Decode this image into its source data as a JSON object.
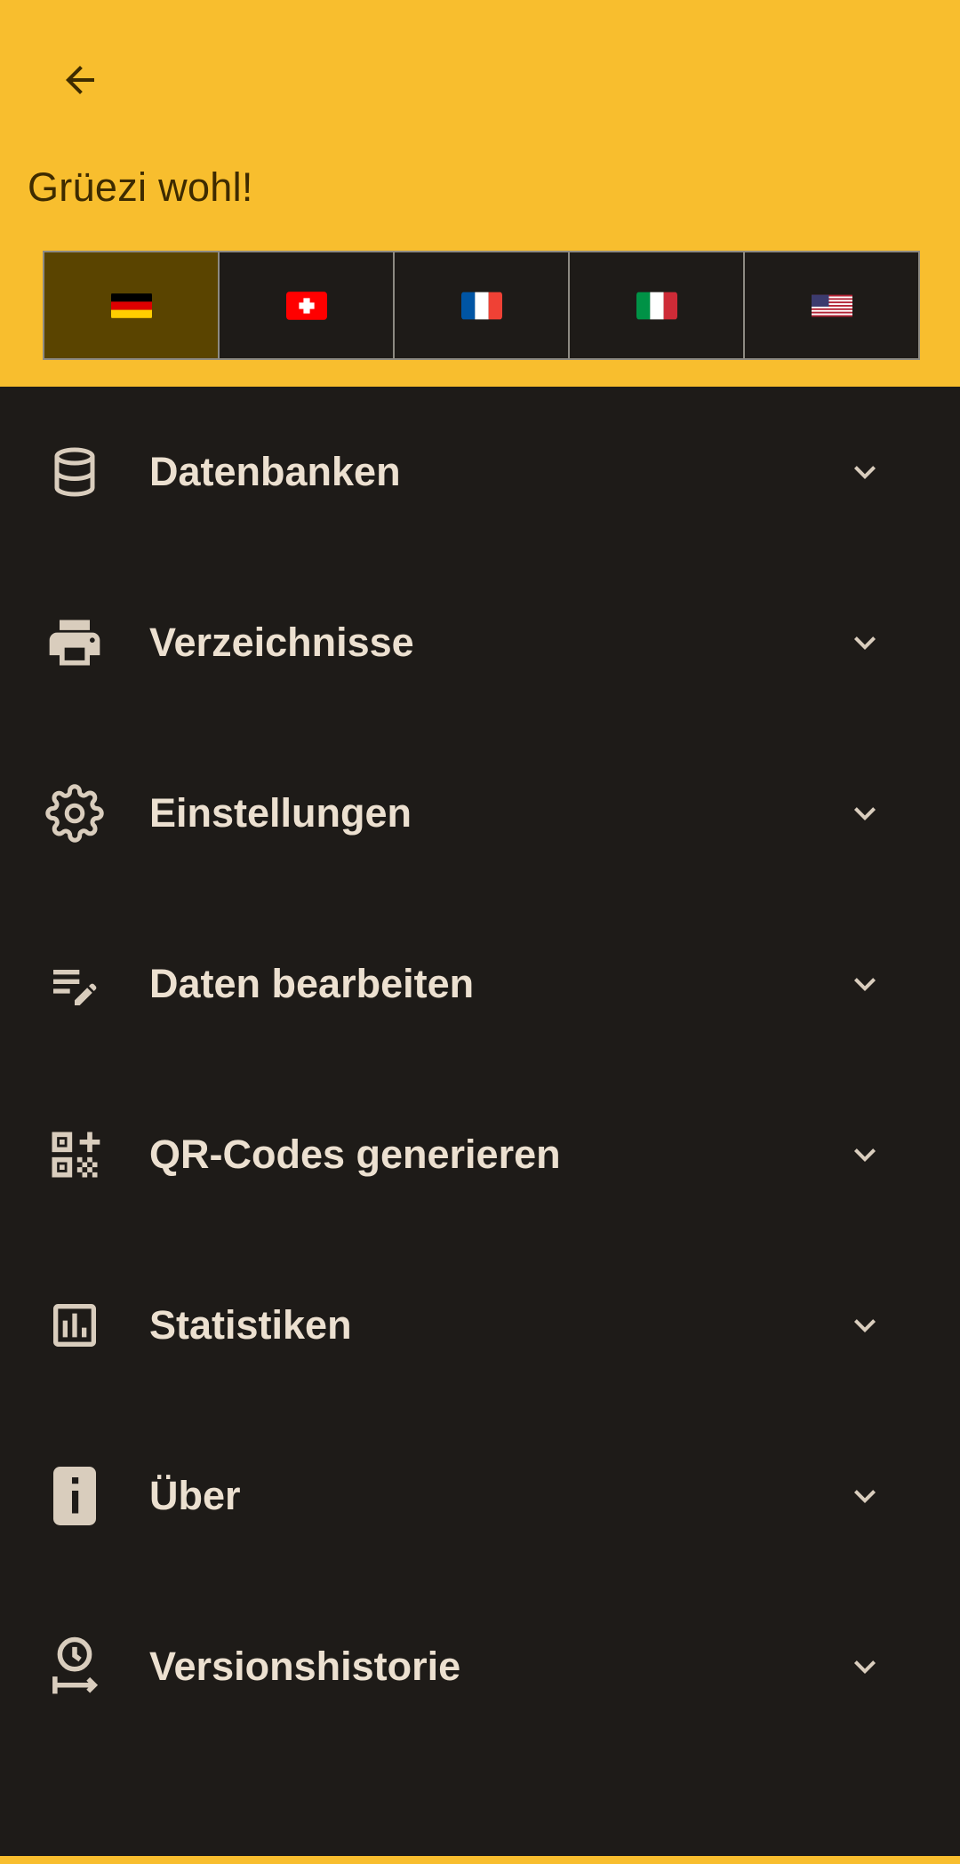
{
  "header": {
    "greeting": "Grüezi wohl!",
    "background_color": "#f8be2e",
    "back_icon": "arrow-back-icon"
  },
  "languages": {
    "selected": "de",
    "items": [
      {
        "code": "de",
        "icon": "flag-germany-icon"
      },
      {
        "code": "ch",
        "icon": "flag-switzerland-icon"
      },
      {
        "code": "fr",
        "icon": "flag-france-icon"
      },
      {
        "code": "it",
        "icon": "flag-italy-icon"
      },
      {
        "code": "us",
        "icon": "flag-usa-icon"
      }
    ]
  },
  "menu": {
    "items": [
      {
        "label": "Datenbanken",
        "icon": "database-icon"
      },
      {
        "label": "Verzeichnisse",
        "icon": "printer-icon"
      },
      {
        "label": "Einstellungen",
        "icon": "gear-icon"
      },
      {
        "label": "Daten bearbeiten",
        "icon": "edit-note-icon"
      },
      {
        "label": "QR-Codes generieren",
        "icon": "qr-code-add-icon"
      },
      {
        "label": "Statistiken",
        "icon": "bar-chart-icon"
      },
      {
        "label": "Über",
        "icon": "info-icon"
      },
      {
        "label": "Versionshistorie",
        "icon": "history-icon"
      }
    ],
    "chevron_icon": "chevron-down-icon"
  },
  "colors": {
    "background": "#1e1b18",
    "menu_text": "#ece0d0",
    "selected_flag_bg": "#5a4400"
  }
}
